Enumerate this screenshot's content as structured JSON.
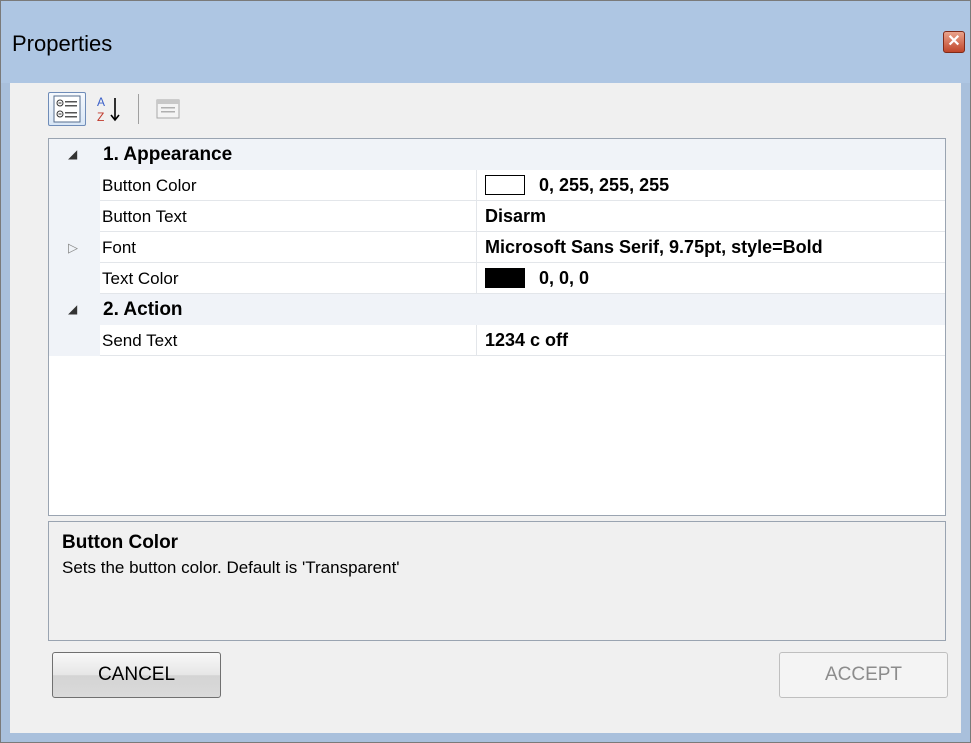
{
  "window": {
    "title": "Properties",
    "close_icon": "✕"
  },
  "toolbar": {
    "categorized_icon": "categorized-icon",
    "alphabetical_icon": "sort-az-icon",
    "property_pages_icon": "property-pages-icon"
  },
  "grid": {
    "categories": [
      {
        "label": "1. Appearance",
        "expanded": true,
        "properties": [
          {
            "name": "Button Color",
            "value": "0, 255, 255, 255",
            "swatch": "#ffffff"
          },
          {
            "name": "Button Text",
            "value": "Disarm"
          },
          {
            "name": "Font",
            "value": "Microsoft Sans Serif, 9.75pt, style=Bold",
            "expandable": true
          },
          {
            "name": "Text Color",
            "value": "0, 0, 0",
            "swatch": "#000000"
          }
        ]
      },
      {
        "label": "2. Action",
        "expanded": true,
        "properties": [
          {
            "name": "Send Text",
            "value": "1234 c off"
          }
        ]
      }
    ]
  },
  "description": {
    "title": "Button Color",
    "text": "Sets the button color.  Default is 'Transparent'"
  },
  "buttons": {
    "cancel": "CANCEL",
    "accept": "ACCEPT"
  }
}
